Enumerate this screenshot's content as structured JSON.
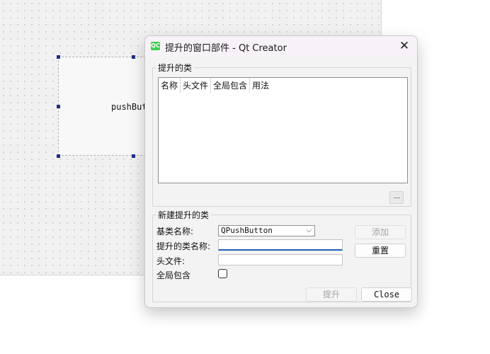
{
  "designer": {
    "push_button_label": "pushButt"
  },
  "dialog": {
    "app_icon_text": "QC",
    "title": "提升的窗口部件 - Qt Creator",
    "close_glyph": "✕",
    "promoted_group": {
      "title": "提升的类",
      "columns": [
        "名称",
        "头文件",
        "全局包含",
        "用法"
      ]
    },
    "new_group": {
      "title": "新建提升的类",
      "base_class_label": "基类名称:",
      "base_class_value": "QPushButton",
      "promoted_class_label": "提升的类名称:",
      "promoted_class_value": "",
      "header_file_label": "头文件:",
      "header_file_value": "",
      "global_include_label": "全局包含",
      "global_include_checked": false,
      "add_button": "添加",
      "reset_button": "重置"
    },
    "promote_button": "提升",
    "close_button": "Close"
  },
  "colors": {
    "focus_accent": "#1c62b9",
    "handle": "#1f2d8a",
    "qt_green": "#41cd52"
  }
}
